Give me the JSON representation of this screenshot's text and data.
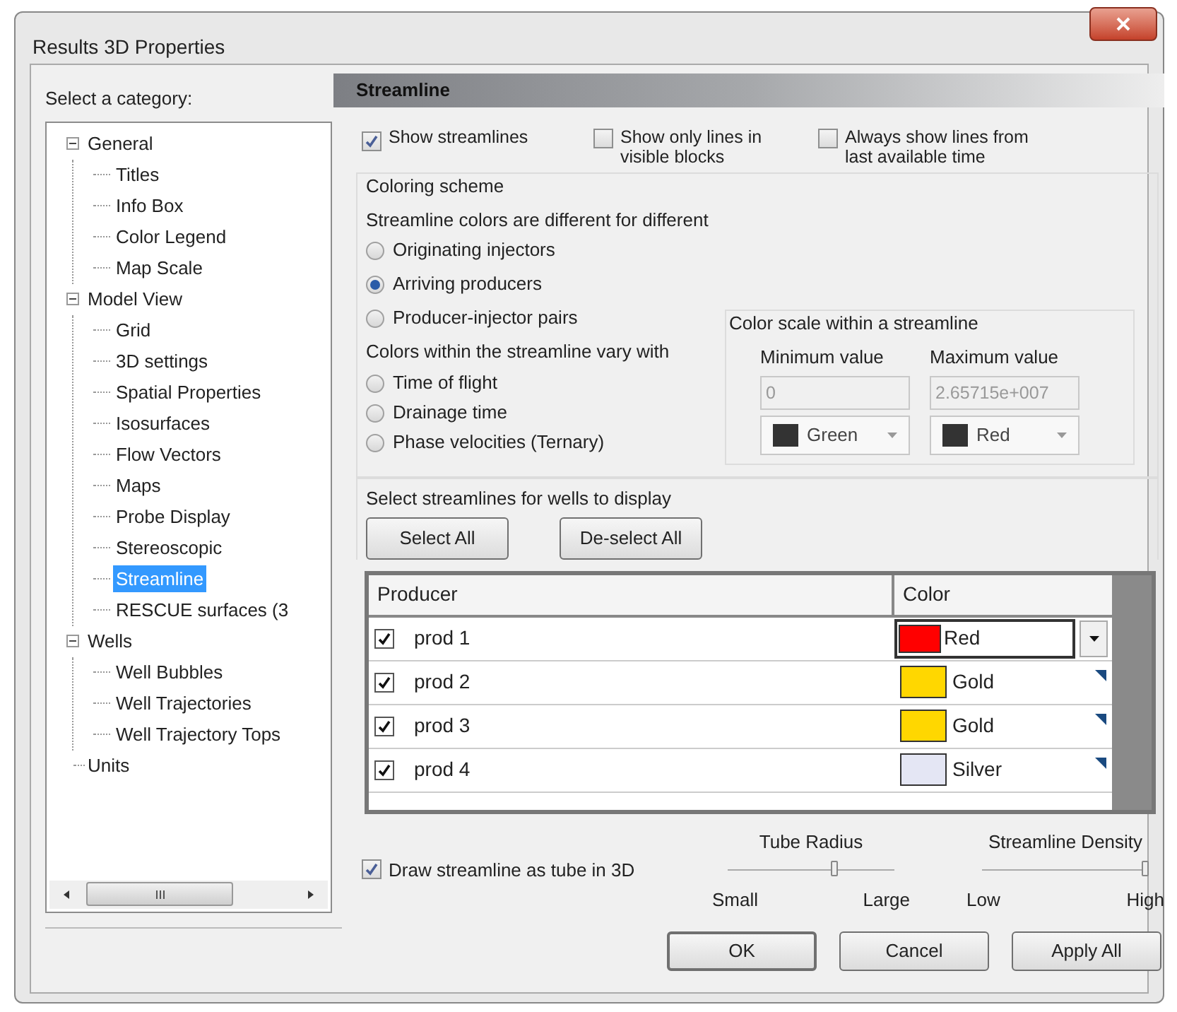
{
  "window": {
    "title": "Results 3D Properties"
  },
  "category_panel": {
    "label": "Select a category:",
    "tree": [
      {
        "label": "General",
        "selected": false,
        "expanded": true,
        "children": [
          {
            "label": "Titles",
            "selected": false
          },
          {
            "label": "Info Box",
            "selected": false
          },
          {
            "label": "Color Legend",
            "selected": false
          },
          {
            "label": "Map Scale",
            "selected": false
          }
        ]
      },
      {
        "label": "Model View",
        "selected": false,
        "expanded": true,
        "children": [
          {
            "label": "Grid",
            "selected": false
          },
          {
            "label": "3D settings",
            "selected": false
          },
          {
            "label": "Spatial Properties",
            "selected": false
          },
          {
            "label": "Isosurfaces",
            "selected": false
          },
          {
            "label": "Flow Vectors",
            "selected": false
          },
          {
            "label": "Maps",
            "selected": false
          },
          {
            "label": "Probe Display",
            "selected": false
          },
          {
            "label": "Stereoscopic",
            "selected": false
          },
          {
            "label": "Streamline",
            "selected": true
          },
          {
            "label": "RESCUE surfaces (3",
            "selected": false
          }
        ]
      },
      {
        "label": "Wells",
        "selected": false,
        "expanded": true,
        "children": [
          {
            "label": "Well Bubbles",
            "selected": false
          },
          {
            "label": "Well Trajectories",
            "selected": false
          },
          {
            "label": "Well Trajectory Tops",
            "selected": false
          }
        ]
      },
      {
        "label": "Units",
        "selected": false
      }
    ]
  },
  "panel": {
    "header": "Streamline",
    "options": [
      {
        "label": "Show streamlines",
        "checked": true
      },
      {
        "label": "Show only lines in visible blocks",
        "checked": false
      },
      {
        "label": "Always show lines from last available time",
        "checked": false
      }
    ],
    "coloring_scheme": {
      "title": "Coloring scheme",
      "prompt": "Streamline colors are different for different",
      "radios": [
        {
          "label": "Originating injectors",
          "selected": false
        },
        {
          "label": "Arriving producers",
          "selected": true
        },
        {
          "label": "Producer-injector pairs",
          "selected": false
        }
      ]
    },
    "vary": {
      "prompt": "Colors within the streamline vary with",
      "radios": [
        {
          "label": "Time of flight",
          "selected": false
        },
        {
          "label": "Drainage time",
          "selected": false
        },
        {
          "label": "Phase velocities (Ternary)",
          "selected": false
        }
      ]
    },
    "color_scale": {
      "title": "Color scale within a streamline",
      "columns": [
        {
          "label": "Minimum value",
          "value": "0",
          "disabled": true,
          "color_name": "Green",
          "color": "#333333"
        },
        {
          "label": "Maximum value",
          "value": "2.65715e+007",
          "disabled": true,
          "color_name": "Red",
          "color": "#333333"
        }
      ]
    },
    "wells": {
      "prompt": "Select streamlines for wells to display",
      "buttons": [
        "Select All",
        "De-select All"
      ],
      "columns": [
        "Producer",
        "Color"
      ],
      "rows": [
        {
          "checked": true,
          "name": "prod 1",
          "color_name": "Red",
          "color": "#ff0000",
          "editing": true
        },
        {
          "checked": true,
          "name": "prod 2",
          "color_name": "Gold",
          "color": "#ffd700",
          "editing": false
        },
        {
          "checked": true,
          "name": "prod 3",
          "color_name": "Gold",
          "color": "#ffd700",
          "editing": false
        },
        {
          "checked": true,
          "name": "prod 4",
          "color_name": "Silver",
          "color": "#e4e6f4",
          "editing": false
        }
      ]
    },
    "tube": {
      "label": "Draw streamline as tube in 3D",
      "checked": true
    },
    "sliders": [
      {
        "title": "Tube Radius",
        "min_label": "Small",
        "max_label": "Large",
        "level": 0.66
      },
      {
        "title": "Streamline Density",
        "min_label": "Low",
        "max_label": "High",
        "level": 1
      }
    ]
  },
  "buttons": [
    {
      "label": "OK",
      "default": true
    },
    {
      "label": "Cancel",
      "default": false
    },
    {
      "label": "Apply All",
      "default": false
    }
  ]
}
